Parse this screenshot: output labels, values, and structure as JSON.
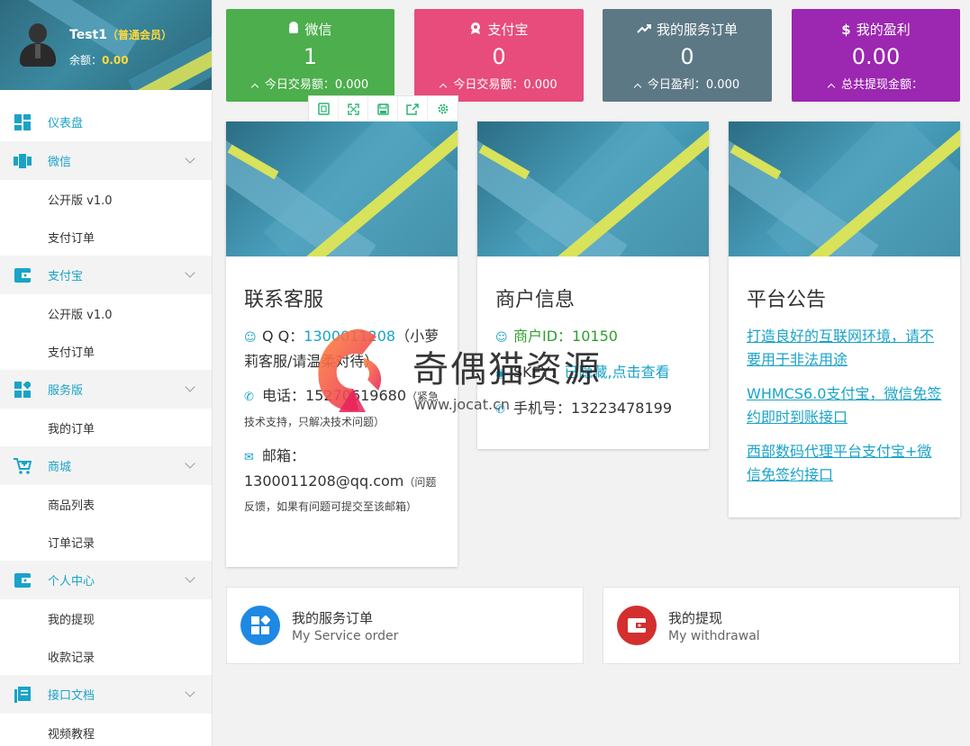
{
  "user": {
    "name": "Test1",
    "level": "（普通会员）",
    "balance_label": "余额：",
    "balance_value": "0.00"
  },
  "menu": [
    {
      "label": "仪表盘",
      "icon": "dashboard-icon",
      "children": []
    },
    {
      "label": "微信",
      "icon": "wechat-icon",
      "children": [
        "公开版 v1.0",
        "支付订单"
      ]
    },
    {
      "label": "支付宝",
      "icon": "wallet-icon",
      "children": [
        "公开版 v1.0",
        "支付订单"
      ]
    },
    {
      "label": "服务版",
      "icon": "apps-icon",
      "children": [
        "我的订单"
      ]
    },
    {
      "label": "商城",
      "icon": "cart-icon",
      "children": [
        "商品列表",
        "订单记录"
      ]
    },
    {
      "label": "个人中心",
      "icon": "wallet-icon",
      "children": [
        "我的提现",
        "收款记录"
      ]
    },
    {
      "label": "接口文档",
      "icon": "book-icon",
      "children": [
        "视频教程"
      ]
    }
  ],
  "stats": [
    {
      "label": "微信",
      "value": "1",
      "sub": "今日交易额：0.000",
      "color": "#4cae4c",
      "icon": "android-icon"
    },
    {
      "label": "支付宝",
      "value": "0",
      "sub": "今日交易额：0.000",
      "color": "#e74c7c",
      "icon": "badge-icon"
    },
    {
      "label": "我的服务订单",
      "value": "0",
      "sub": "今日盈利：0.000",
      "color": "#5d7885",
      "icon": "trend-icon"
    },
    {
      "label": "我的盈利",
      "value": "0.00",
      "sub": "总共提现金额：",
      "color": "#9c27b0",
      "icon": "dollar-icon"
    }
  ],
  "contact": {
    "title": "联系客服",
    "qq_label": "Q Q：",
    "qq_value": "1300011208",
    "qq_note": "（小萝莉客服/请温柔对待）",
    "phone_label": "电话：",
    "phone_value": "15270619680",
    "phone_note": "（紧急技术支持，只解决技术问题）",
    "email_label": "邮箱：",
    "email_value": "1300011208@qq.com",
    "email_note": "（问题反馈，如果有问题可提交至该邮箱）"
  },
  "merchant": {
    "title": "商户信息",
    "id_label": "商户ID：",
    "id_value": "10150",
    "skey_label": "SKEY：",
    "skey_value": "已隐藏,点击查看",
    "mobile_label": "手机号：",
    "mobile_value": "13223478199"
  },
  "notice": {
    "title": "平台公告",
    "items": [
      "打造良好的互联网环境，请不要用于非法用途",
      "WHMCS6.0支付宝，微信免签约即时到账接口",
      "西部数码代理平台支付宝+微信免签约接口"
    ]
  },
  "quick": [
    {
      "title": "我的服务订单",
      "subtitle": "My Service order",
      "color": "#1e88e5",
      "icon": "apps-icon"
    },
    {
      "title": "我的提现",
      "subtitle": "My withdrawal",
      "color": "#d32f2f",
      "icon": "wallet-icon"
    }
  ],
  "watermark": {
    "text": "奇偶猫资源",
    "url": "www.jocat.cn"
  }
}
